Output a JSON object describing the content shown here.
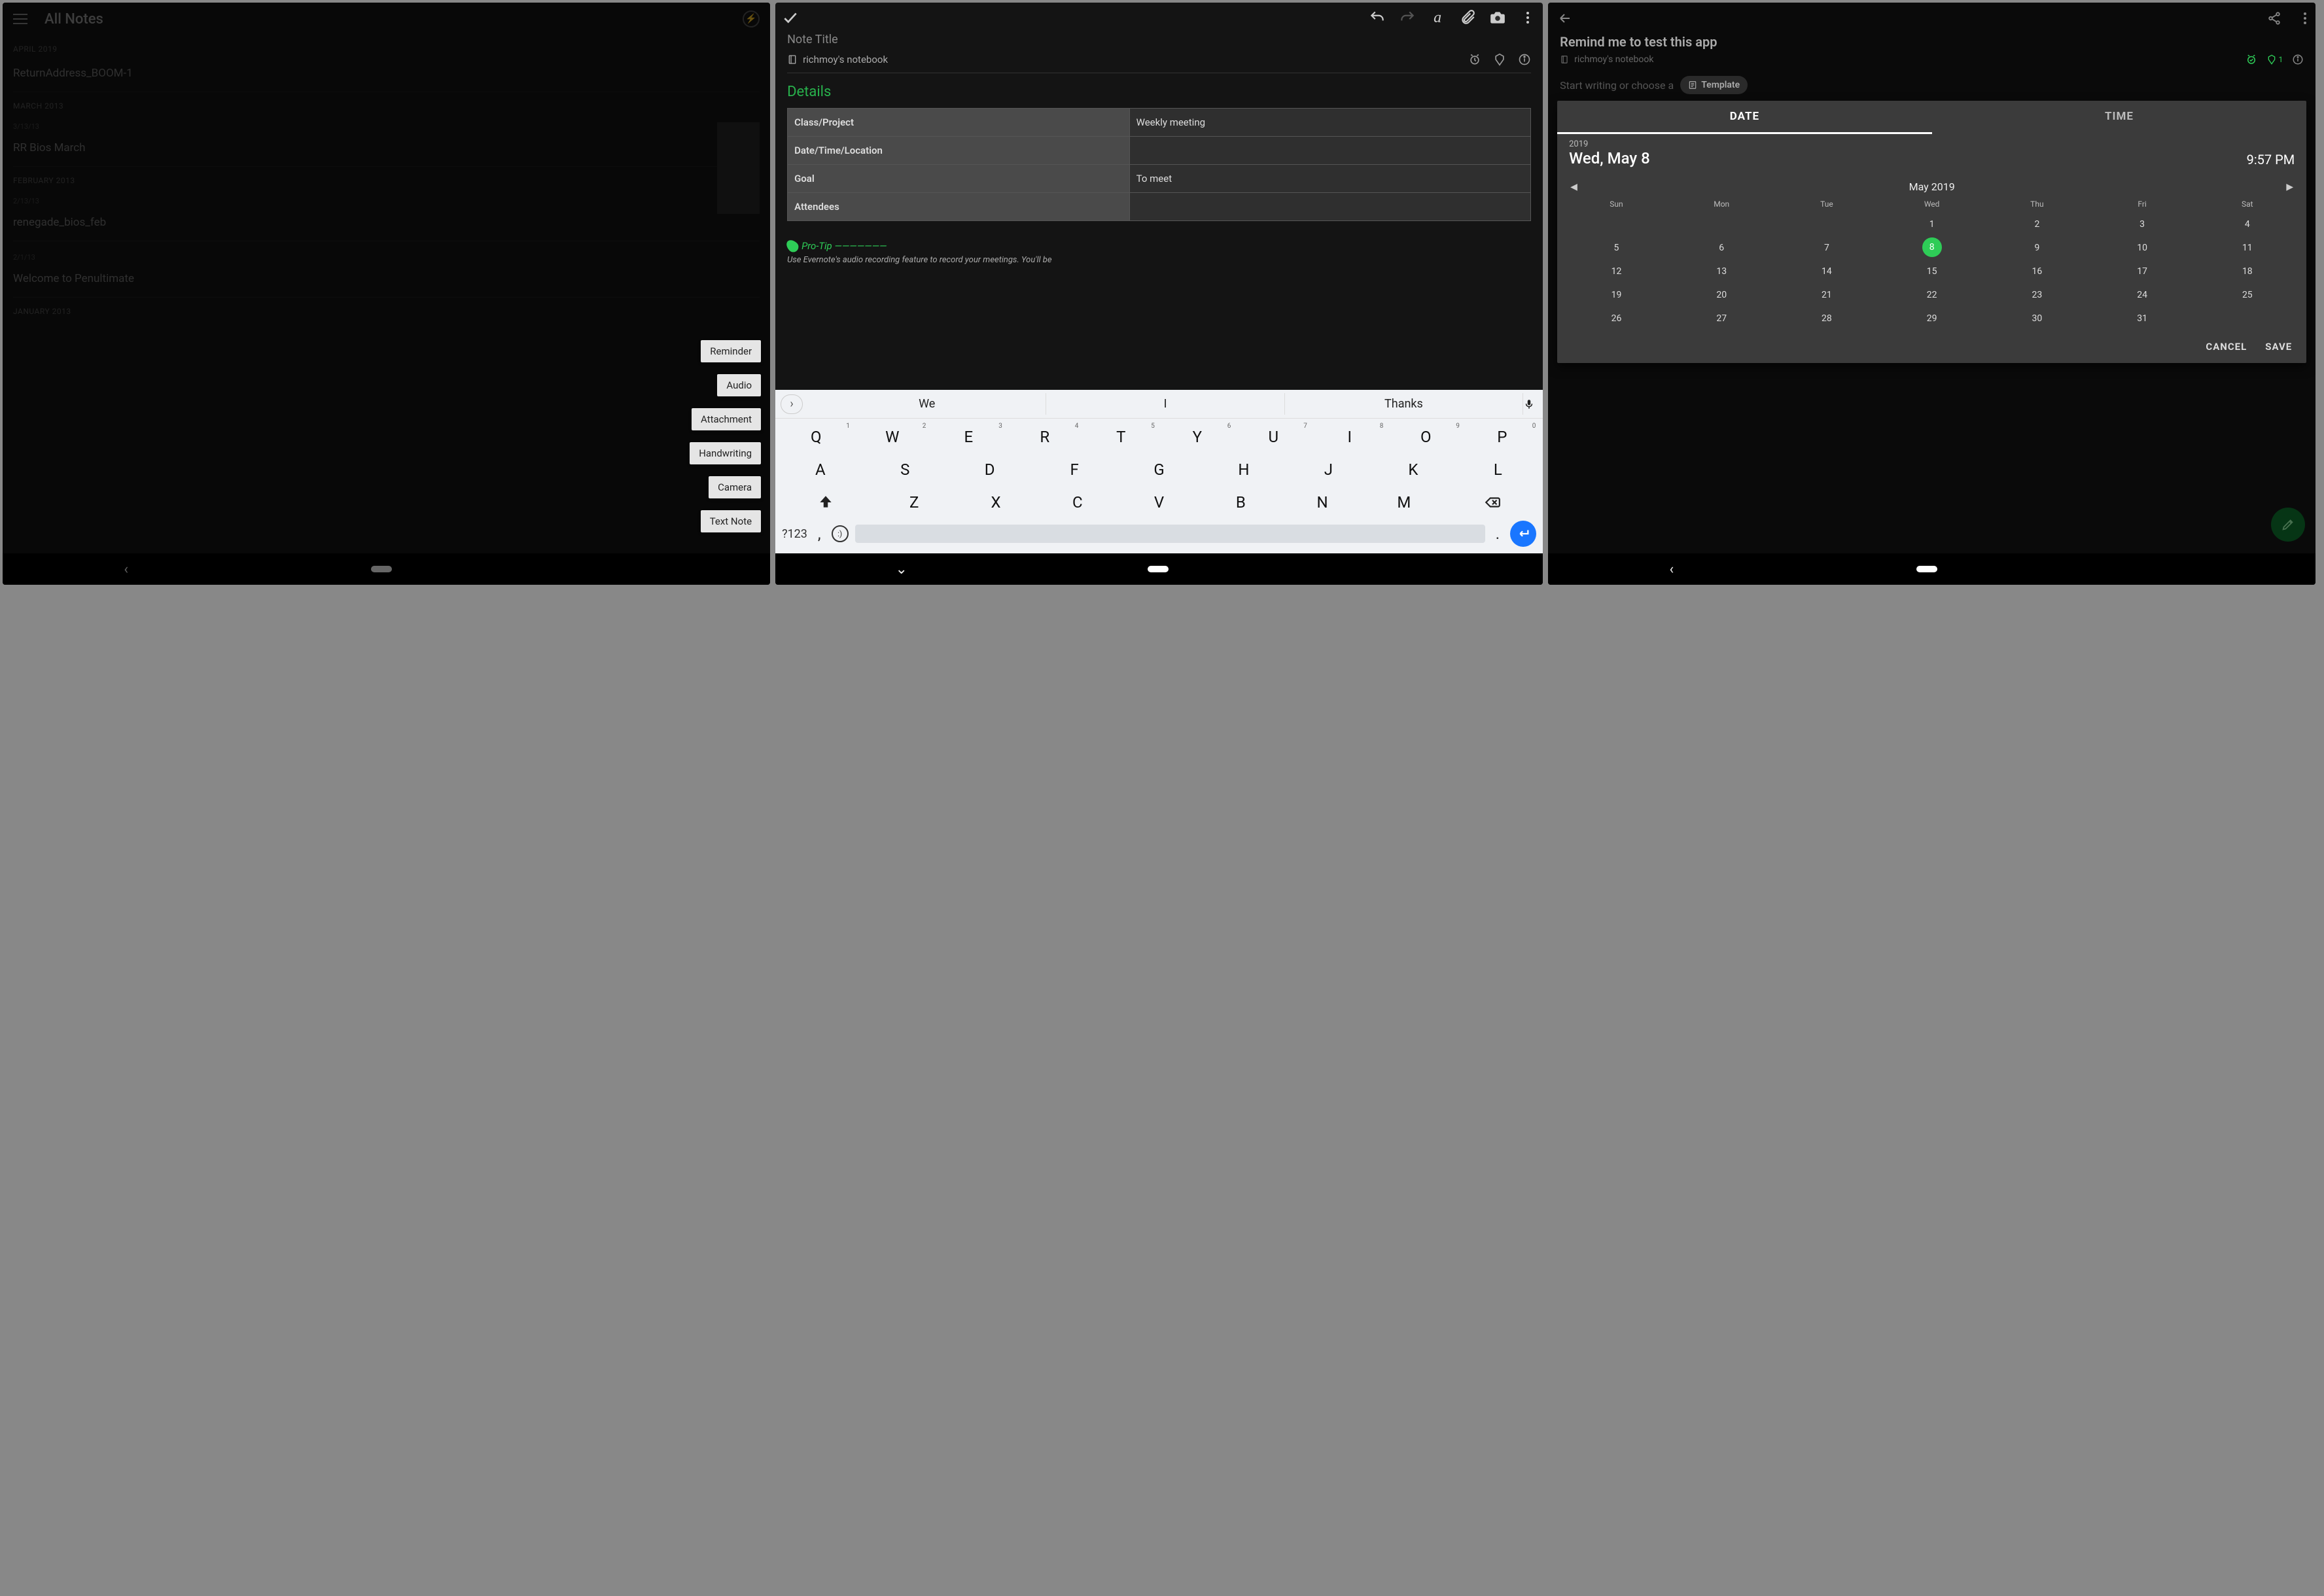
{
  "panel1": {
    "title": "All Notes",
    "sections": [
      {
        "header": "APRIL 2019",
        "items": [
          {
            "date": "",
            "title": "ReturnAddress_BOOM-1"
          }
        ]
      },
      {
        "header": "MARCH 2013",
        "items": [
          {
            "date": "3/13/13",
            "title": "RR Bios March"
          }
        ]
      },
      {
        "header": "FEBRUARY 2013",
        "items": [
          {
            "date": "2/13/13",
            "title": "renegade_bios_feb"
          },
          {
            "date": "2/1/13",
            "title": "Welcome to Penultimate"
          }
        ]
      },
      {
        "header": "JANUARY 2013",
        "items": []
      }
    ],
    "fab_menu": [
      "Reminder",
      "Audio",
      "Attachment",
      "Handwriting",
      "Camera",
      "Text Note"
    ]
  },
  "panel2": {
    "title_label": "Note Title",
    "notebook": "richmoy's notebook",
    "details_header": "Details",
    "table": [
      {
        "label": "Class/Project",
        "value": "Weekly meeting"
      },
      {
        "label": "Date/Time/Location",
        "value": ""
      },
      {
        "label": "Goal",
        "value": "To meet"
      },
      {
        "label": "Attendees",
        "value": ""
      }
    ],
    "protip_label": "Pro-Tip  ———————",
    "protip_text": "Use Evernote's audio recording feature to record your meetings. You'll be",
    "suggestions": [
      "We",
      "I",
      "Thanks"
    ],
    "row1": [
      [
        "Q",
        "1"
      ],
      [
        "W",
        "2"
      ],
      [
        "E",
        "3"
      ],
      [
        "R",
        "4"
      ],
      [
        "T",
        "5"
      ],
      [
        "Y",
        "6"
      ],
      [
        "U",
        "7"
      ],
      [
        "I",
        "8"
      ],
      [
        "O",
        "9"
      ],
      [
        "P",
        "0"
      ]
    ],
    "row2": [
      "A",
      "S",
      "D",
      "F",
      "G",
      "H",
      "J",
      "K",
      "L"
    ],
    "row3": [
      "Z",
      "X",
      "C",
      "V",
      "B",
      "N",
      "M"
    ],
    "sym": "?123"
  },
  "panel3": {
    "title": "Remind me to test this app",
    "notebook": "richmoy's notebook",
    "badge_count": "1",
    "placeholder": "Start writing or choose a",
    "template_btn": "Template",
    "tabs": {
      "date": "DATE",
      "time": "TIME"
    },
    "year": "2019",
    "selected_date": "Wed, May 8",
    "selected_time": "9:57 PM",
    "month_label": "May 2019",
    "dow": [
      "Sun",
      "Mon",
      "Tue",
      "Wed",
      "Thu",
      "Fri",
      "Sat"
    ],
    "weeks": [
      [
        "",
        "",
        "",
        "1",
        "2",
        "3",
        "4"
      ],
      [
        "5",
        "6",
        "7",
        "8",
        "9",
        "10",
        "11"
      ],
      [
        "12",
        "13",
        "14",
        "15",
        "16",
        "17",
        "18"
      ],
      [
        "19",
        "20",
        "21",
        "22",
        "23",
        "24",
        "25"
      ],
      [
        "26",
        "27",
        "28",
        "29",
        "30",
        "31",
        ""
      ]
    ],
    "selected_day": "8",
    "cancel": "CANCEL",
    "save": "SAVE"
  }
}
